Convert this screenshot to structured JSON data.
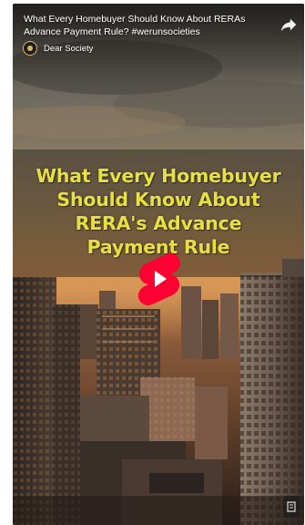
{
  "video": {
    "title": "What Every Homebuyer Should Know About RERAs Advance Payment Rule? #werunsocieties",
    "channel_name": "Dear Society",
    "headline_lines": [
      "What Every Homebuyer",
      "Should Know About",
      "RERA's Advance",
      "Payment Rule"
    ]
  },
  "icons": {
    "share": "share-arrow-icon",
    "play": "youtube-shorts-play-icon",
    "avatar": "channel-avatar-icon"
  },
  "colors": {
    "headline": "#e8e040",
    "shorts_red": "#ff0033",
    "title_text": "#ffffff"
  }
}
